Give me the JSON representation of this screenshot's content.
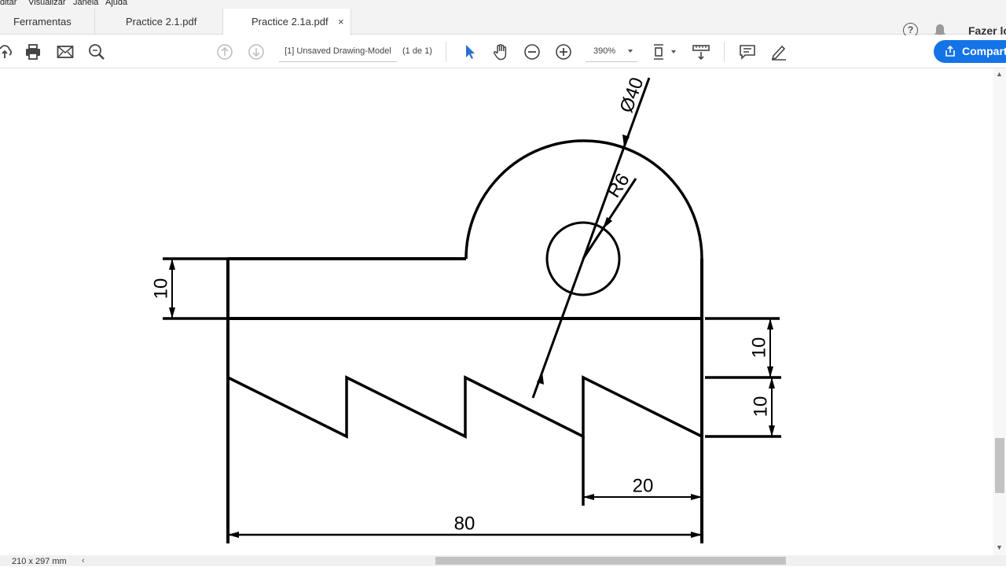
{
  "menu": [
    "ditar",
    "Visualizar",
    "Janela",
    "Ajuda"
  ],
  "tabs": {
    "tools": "Ferramentas",
    "doc1": "Practice 2.1.pdf",
    "doc2": "Practice 2.1a.pdf",
    "close": "×"
  },
  "header": {
    "help": "?",
    "signin": "Fazer lo"
  },
  "toolbar": {
    "doc_name": "[1] Unsaved Drawing-Model",
    "page_count": "(1 de 1)",
    "zoom": "390%",
    "share": "Compart"
  },
  "icons": [
    "upload-icon",
    "print-icon",
    "mail-icon",
    "search-icon",
    "prev-page-icon",
    "next-page-icon",
    "select-arrow-icon",
    "hand-icon",
    "zoom-out-icon",
    "zoom-in-icon",
    "fit-page-icon",
    "measure-icon",
    "comment-icon",
    "sign-icon",
    "bell-icon",
    "share-icon"
  ],
  "colors": {
    "accent": "#1473e6",
    "select_tool": "#2a6fd6",
    "drawing": "#000000"
  },
  "drawing": {
    "dims": {
      "d_top": "10",
      "d_right_upper": "10",
      "d_right_lower": "10",
      "d_20": "20",
      "d_80": "80",
      "diameter": "Ø40",
      "radius": "R6"
    }
  },
  "status": {
    "page_size": "210 x 297 mm",
    "scroll_left": "‹"
  }
}
